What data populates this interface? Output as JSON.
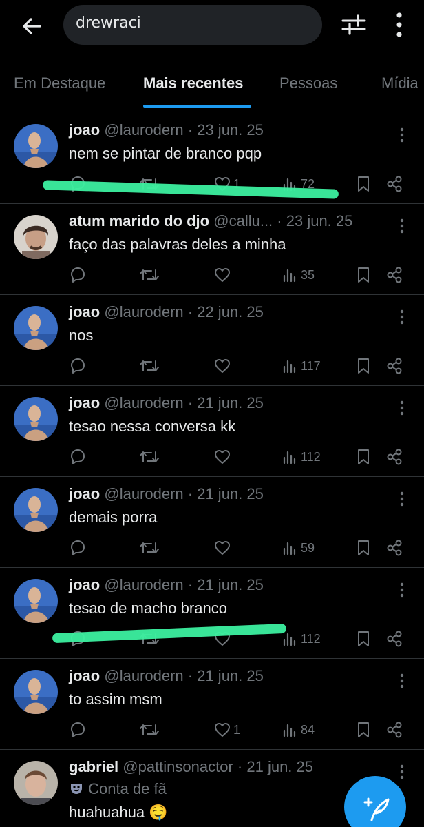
{
  "search": {
    "query": "drewraci"
  },
  "tabs": [
    "Em Destaque",
    "Mais recentes",
    "Pessoas",
    "Mídia"
  ],
  "posts": [
    {
      "name": "joao",
      "handle": "@laurodern",
      "date": "· 23 jun. 25",
      "text": "nem se pintar de branco pqp",
      "likes": "1",
      "views": "72"
    },
    {
      "name": "atum marido do djo",
      "handle": "@callu...",
      "date": "· 23 jun. 25",
      "text": "faço das palavras deles a minha",
      "likes": "",
      "views": "35"
    },
    {
      "name": "joao",
      "handle": "@laurodern",
      "date": "· 22 jun. 25",
      "text": "nos",
      "likes": "",
      "views": "117"
    },
    {
      "name": "joao",
      "handle": "@laurodern",
      "date": "· 21 jun. 25",
      "text": "tesao nessa conversa kk",
      "likes": "",
      "views": "112"
    },
    {
      "name": "joao",
      "handle": "@laurodern",
      "date": "· 21 jun. 25",
      "text": "demais porra",
      "likes": "",
      "views": "59"
    },
    {
      "name": "joao",
      "handle": "@laurodern",
      "date": "· 21 jun. 25",
      "text": "tesao de macho branco",
      "likes": "",
      "views": "112"
    },
    {
      "name": "joao",
      "handle": "@laurodern",
      "date": "· 21 jun. 25",
      "text": "to assim msm",
      "likes": "1",
      "views": "84"
    },
    {
      "name": "gabriel",
      "handle": "@pattinsonactor",
      "date": "· 21 jun. 25",
      "badge": "Conta de fã",
      "text": "huahuahua 🤤"
    }
  ],
  "colors": {
    "accent": "#1d9bf0",
    "highlight": "#3cf0a0",
    "muted": "#71767b",
    "text": "#e7e9ea",
    "background": "#000000"
  },
  "icons": [
    "back-arrow-icon",
    "filter-sliders-icon",
    "more-vertical-icon",
    "reply-icon",
    "repost-icon",
    "like-icon",
    "views-icon",
    "bookmark-icon",
    "share-icon",
    "compose-icon"
  ]
}
